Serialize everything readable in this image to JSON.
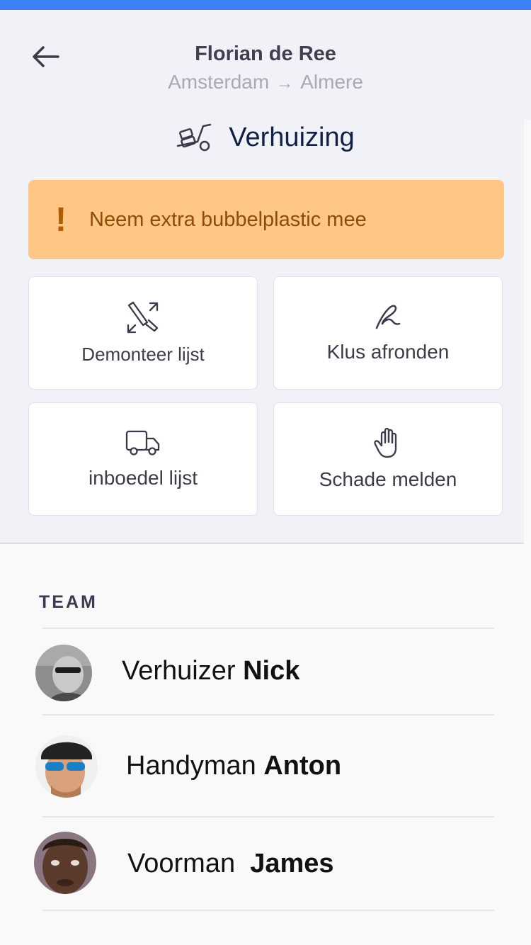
{
  "header": {
    "customer_name": "Florian de Ree",
    "route_from": "Amsterdam",
    "route_arrow": "→",
    "route_to": "Almere"
  },
  "job": {
    "type_label": "Verhuizing",
    "icon": "moving-dolly-icon"
  },
  "alert": {
    "mark": "!",
    "text": "Neem extra bubbelplastic mee",
    "color": "#fec785"
  },
  "actions": [
    {
      "label": "Demonteer lijst",
      "icon": "tools-icon"
    },
    {
      "label": "Klus afronden",
      "icon": "signature-icon"
    },
    {
      "label": "inboedel lijst",
      "icon": "truck-icon"
    },
    {
      "label": "Schade melden",
      "icon": "hand-icon"
    }
  ],
  "team": {
    "title": "TEAM",
    "members": [
      {
        "role": "Verhuizer",
        "name": "Nick"
      },
      {
        "role": "Handyman",
        "name": "Anton"
      },
      {
        "role": "Voorman",
        "name": "James"
      }
    ]
  },
  "colors": {
    "accent": "#3b82f6",
    "title": "#122046",
    "alert_text": "#8f4c06"
  }
}
